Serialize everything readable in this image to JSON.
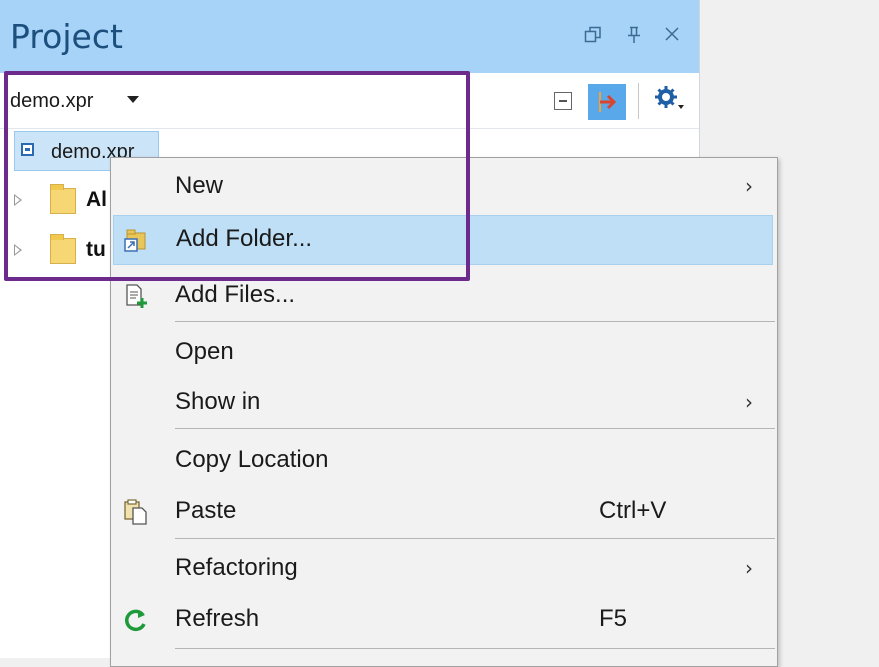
{
  "panel": {
    "title": "Project"
  },
  "toolbar": {
    "project_selector": "demo.xpr"
  },
  "tree": {
    "root": "demo.xpr",
    "children": [
      {
        "label": "Al"
      },
      {
        "label": "tu"
      }
    ]
  },
  "context_menu": {
    "items": [
      {
        "label": "New",
        "submenu": true
      },
      {
        "label": "Add Folder...",
        "highlighted": true
      },
      {
        "label": "Add Files..."
      },
      {
        "label": "Open"
      },
      {
        "label": "Show in",
        "submenu": true
      },
      {
        "label": "Copy Location"
      },
      {
        "label": "Paste",
        "shortcut": "Ctrl+V"
      },
      {
        "label": "Refactoring",
        "submenu": true
      },
      {
        "label": "Refresh",
        "shortcut": "F5"
      }
    ],
    "submenu_glyph": "›"
  },
  "colors": {
    "header_bg": "#a6d3f7",
    "highlight_border": "#6b2a8c",
    "menu_hover": "#bfdff7",
    "refresh_green": "#1e9a3a"
  }
}
